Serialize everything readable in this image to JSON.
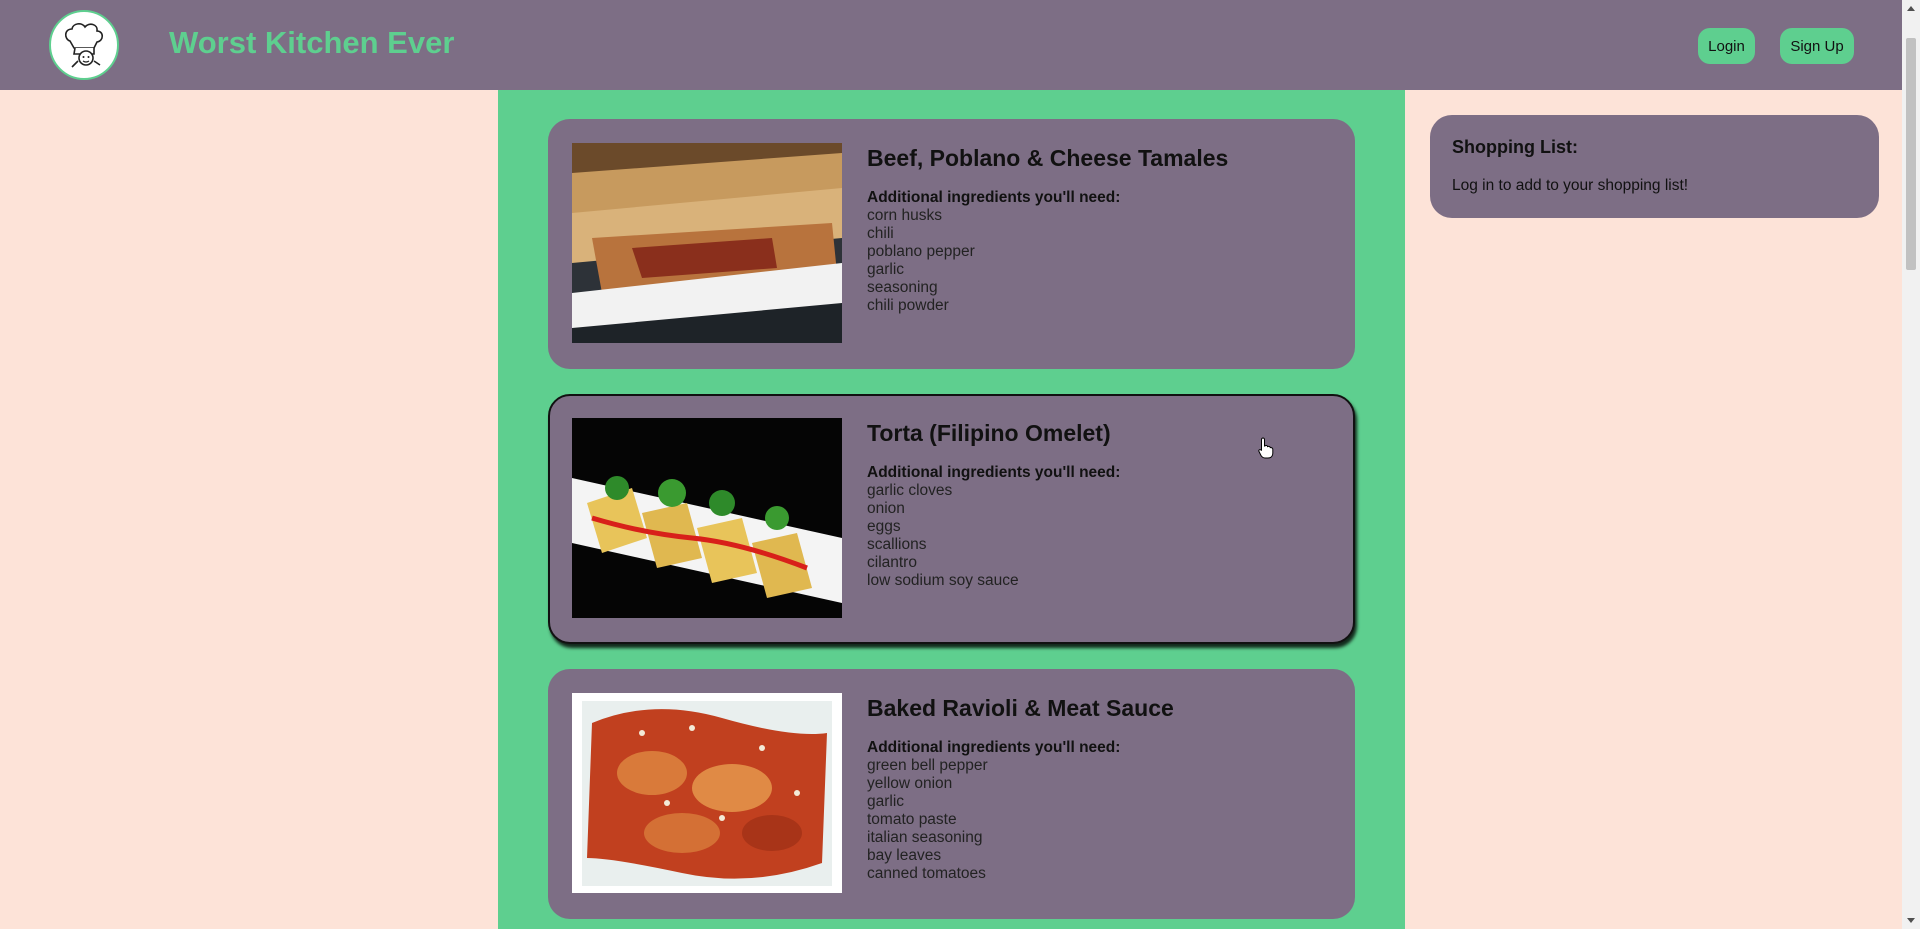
{
  "header": {
    "site_title": "Worst Kitchen Ever",
    "logo_icon": "chef-hat-icon",
    "login_label": "Login",
    "signup_label": "Sign Up"
  },
  "recipes": [
    {
      "title": "Beef, Poblano & Cheese Tamales",
      "ingredients_heading": "Additional ingredients you'll need:",
      "ingredients": [
        "corn husks",
        "chili",
        "poblano pepper",
        "garlic",
        "seasoning",
        "chili powder"
      ]
    },
    {
      "title": "Torta (Filipino Omelet)",
      "ingredients_heading": "Additional ingredients you'll need:",
      "ingredients": [
        "garlic cloves",
        "onion",
        "eggs",
        "scallions",
        "cilantro",
        "low sodium soy sauce"
      ]
    },
    {
      "title": "Baked Ravioli & Meat Sauce",
      "ingredients_heading": "Additional ingredients you'll need:",
      "ingredients": [
        "green bell pepper",
        "yellow onion",
        "garlic",
        "tomato paste",
        "italian seasoning",
        "bay leaves",
        "canned tomatoes"
      ]
    }
  ],
  "shopping_list": {
    "title": "Shopping List:",
    "message": "Log in to add to your shopping list!"
  },
  "colors": {
    "header_bg": "#7d6e85",
    "accent": "#5ecf8f",
    "page_bg": "#fde3d8"
  }
}
